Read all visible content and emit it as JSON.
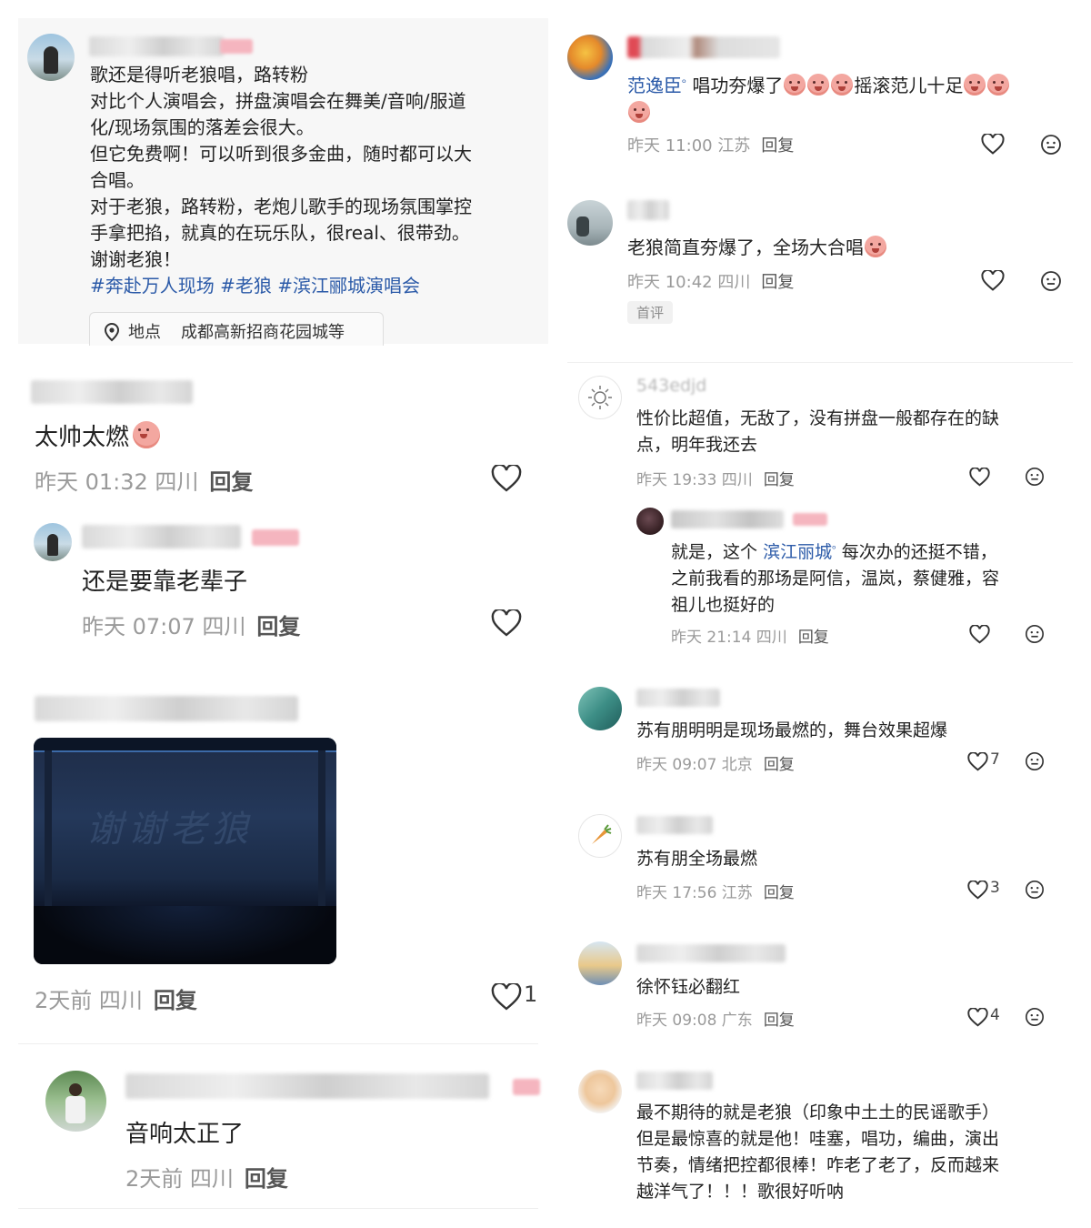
{
  "left": {
    "post": {
      "lines": [
        "歌还是得听老狼唱，路转粉",
        "对比个人演唱会，拼盘演唱会在舞美/音响/服道",
        "化/现场氛围的落差会很大。",
        "但它免费啊！可以听到很多金曲，随时都可以大",
        "合唱。",
        "对于老狼，路转粉，老炮儿歌手的现场氛围掌控",
        "手拿把掐，就真的在玩乐队，很real、很带劲。",
        "谢谢老狼！"
      ],
      "hashtags": "#奔赴万人现场 #老狼 #滨江郦城演唱会",
      "location_label": "地点",
      "location_value": "成都高新招商花园城等"
    },
    "comments": [
      {
        "text": "太帅太燃",
        "time": "昨天 01:32 四川",
        "reply": "回复"
      },
      {
        "text": "还是要靠老辈子",
        "time": "昨天 07:07 四川",
        "reply": "回复"
      },
      {
        "image_caption": "谢谢老狼",
        "time": "2天前 四川",
        "reply": "回复",
        "likes": "1"
      },
      {
        "text": "音响太正了",
        "time": "2天前 四川",
        "reply": "回复"
      }
    ]
  },
  "right": {
    "comments": [
      {
        "mention": "范逸臣",
        "text": "唱功夯爆了",
        "text2": "摇滚范儿十足",
        "time": "昨天 11:00 江苏",
        "reply": "回复"
      },
      {
        "text": "老狼简直夯爆了，全场大合唱",
        "time": "昨天 10:42 四川",
        "reply": "回复",
        "badge": "首评"
      },
      {
        "name": "543edjd",
        "lines": [
          "性价比超值，无敌了，没有拼盘一般都存在的缺",
          "点，明年我还去"
        ],
        "time": "昨天 19:33 四川",
        "reply": "回复",
        "sub": {
          "prefix": "就是，这个",
          "mention": "滨江丽城",
          "suffix": "每次办的还挺不错，",
          "lines": [
            "之前我看的那场是阿信，温岚，蔡健雅，容",
            "祖儿也挺好的"
          ],
          "time": "昨天 21:14 四川",
          "reply": "回复"
        }
      },
      {
        "text": "苏有朋明明是现场最燃的，舞台效果超爆",
        "time": "昨天 09:07 北京",
        "reply": "回复",
        "likes": "7"
      },
      {
        "text": "苏有朋全场最燃",
        "time": "昨天 17:56 江苏",
        "reply": "回复",
        "likes": "3"
      },
      {
        "text": "徐怀钰必翻红",
        "time": "昨天 09:08 广东",
        "reply": "回复",
        "likes": "4"
      },
      {
        "lines": [
          "最不期待的就是老狼（印象中土土的民谣歌手）",
          "但是最惊喜的就是他！哇塞，唱功，编曲，演出",
          "节奏，情绪把控都很棒！咋老了老了，反而越来",
          "越洋气了！！！歌很好听呐"
        ]
      }
    ]
  },
  "colors": {
    "link": "#2b5aa8",
    "meta": "#9a9a9a",
    "panel": "#f7f7f7"
  },
  "icons": [
    "heart-icon",
    "emoji-face-icon",
    "location-pin-icon"
  ]
}
